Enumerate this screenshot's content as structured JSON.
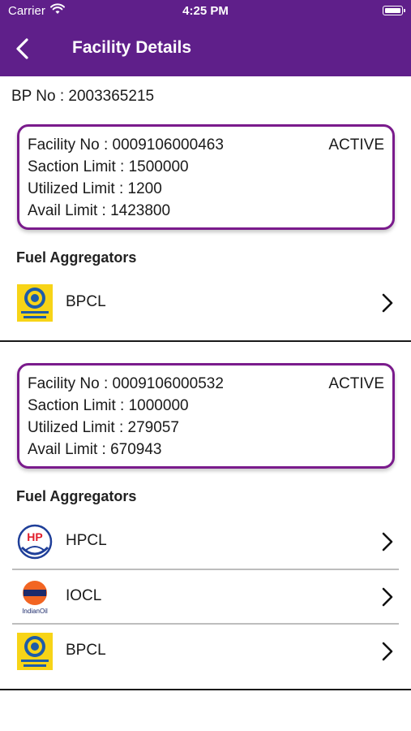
{
  "status_bar": {
    "carrier": "Carrier",
    "time": "4:25 PM"
  },
  "header": {
    "title": "Facility Details"
  },
  "bp": {
    "label": "BP No : 2003365215"
  },
  "facilities": [
    {
      "facility_no": "Facility No : 0009106000463",
      "status": "ACTIVE",
      "sanction_limit": "Saction Limit : 1500000",
      "utilized_limit": "Utilized Limit : 1200",
      "avail_limit": "Avail Limit : 1423800",
      "aggregators_title": "Fuel Aggregators",
      "aggregators": [
        {
          "name": "BPCL",
          "logo": "bpcl-logo",
          "logo_text": "Bharat Petroleum"
        }
      ]
    },
    {
      "facility_no": "Facility No : 0009106000532",
      "status": "ACTIVE",
      "sanction_limit": "Saction Limit : 1000000",
      "utilized_limit": "Utilized Limit : 279057",
      "avail_limit": "Avail Limit : 670943",
      "aggregators_title": "Fuel Aggregators",
      "aggregators": [
        {
          "name": "HPCL",
          "logo": "hpcl-logo",
          "logo_text": "HP"
        },
        {
          "name": "IOCL",
          "logo": "iocl-logo",
          "logo_text": "IndianOil"
        },
        {
          "name": "BPCL",
          "logo": "bpcl-logo",
          "logo_text": "Bharat Petroleum"
        }
      ]
    }
  ],
  "colors": {
    "header_bg": "#5f1f8a",
    "card_border": "#7a1b8c",
    "bpcl_yellow": "#f7d417",
    "bpcl_blue": "#1d5ca8",
    "hp_red": "#e11d2a",
    "hp_blue": "#1f3f99",
    "iocl_orange": "#f26522",
    "iocl_navy": "#1c2a6b"
  },
  "icons": {
    "back": "chevron-left-icon",
    "row_chevron": "chevron-right-icon",
    "wifi": "wifi-icon",
    "battery": "battery-icon"
  }
}
